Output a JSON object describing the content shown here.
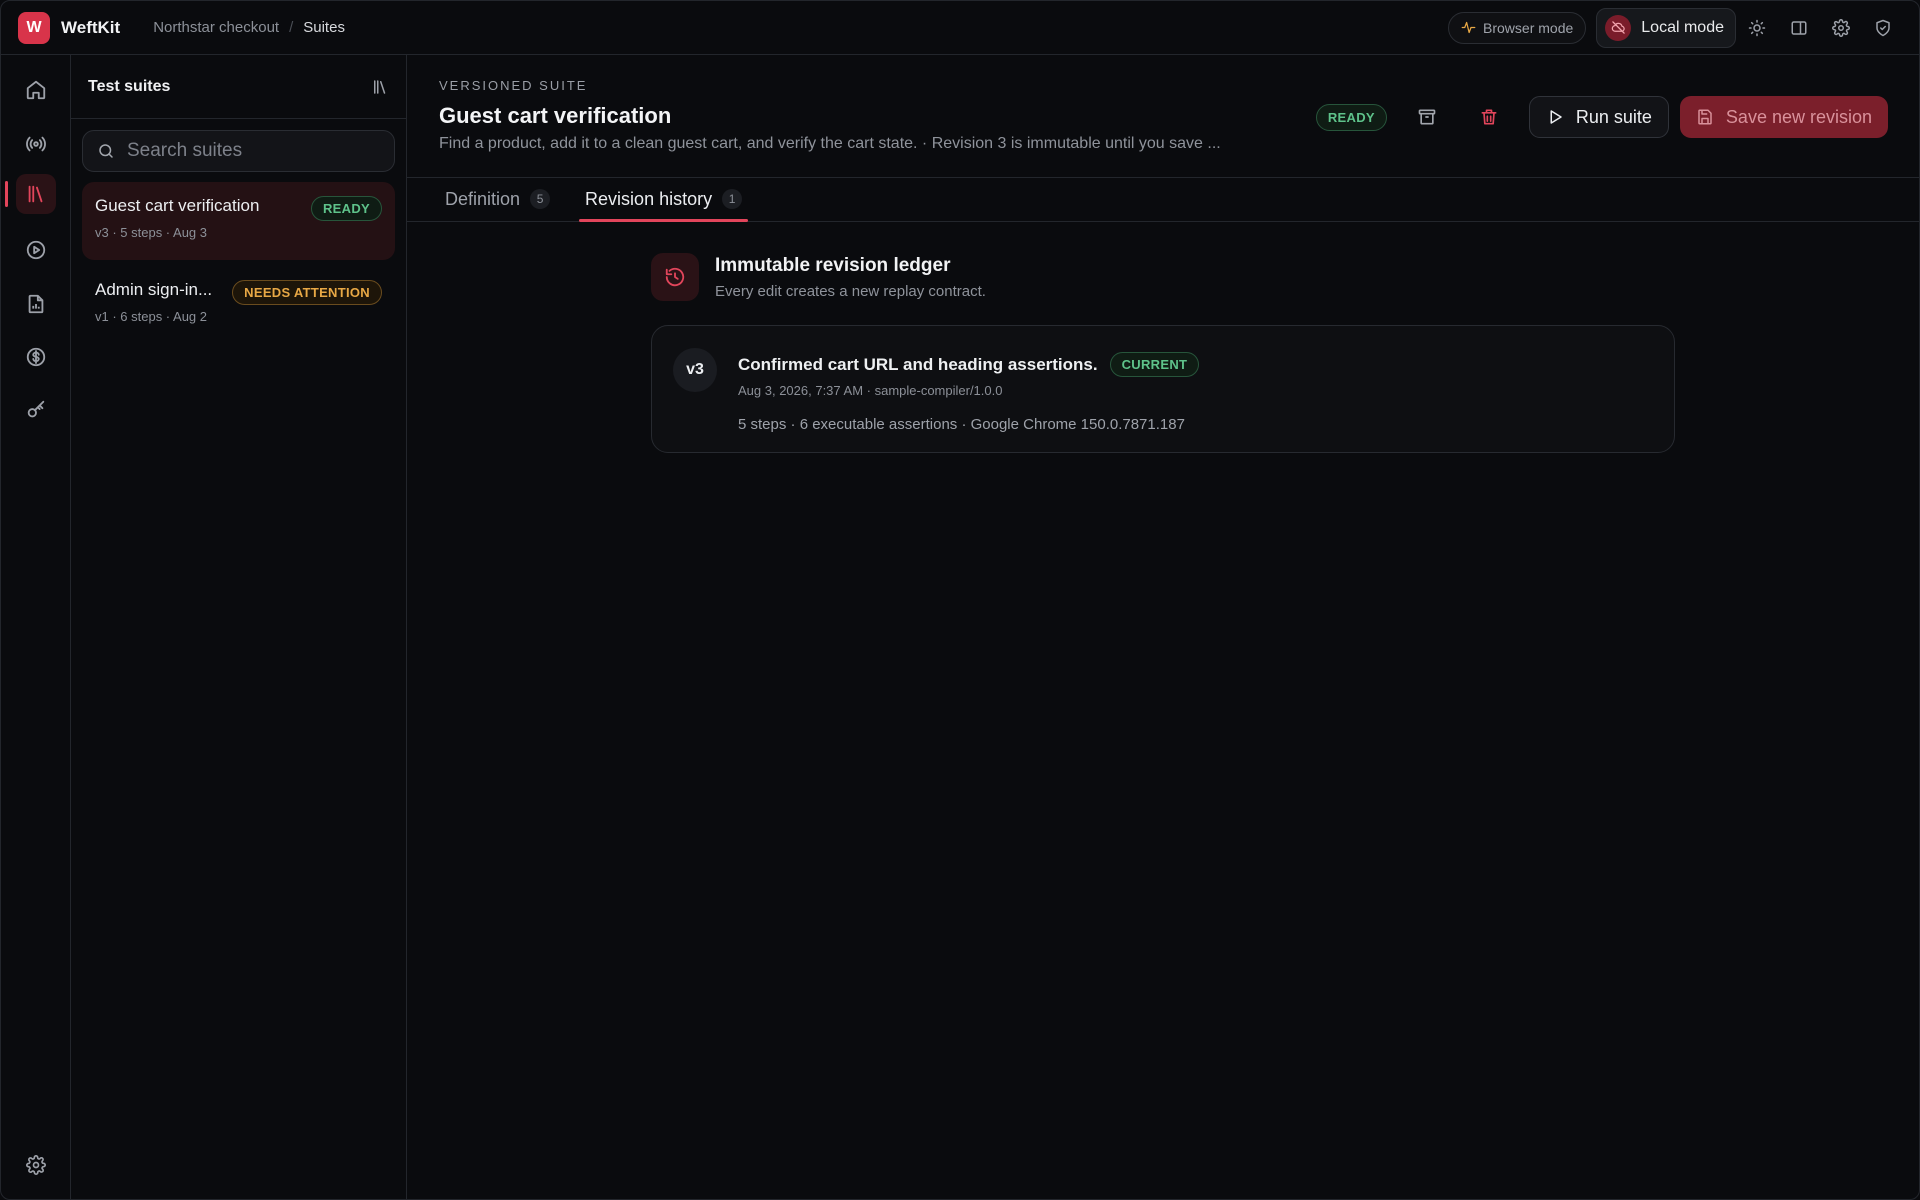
{
  "app": {
    "logo_letter": "W",
    "brand": "WeftKit"
  },
  "breadcrumb": [
    "Northstar checkout",
    "Suites"
  ],
  "breadcrumb_sep": "/",
  "topbar": {
    "browser_mode": "Browser mode",
    "local_mode": "Local mode",
    "icons": [
      "sun-icon",
      "panel-icon",
      "gear-icon",
      "shield-icon"
    ]
  },
  "rail": {
    "items": [
      "home-icon",
      "broadcast-icon",
      "library-icon",
      "play-circle-icon",
      "report-icon",
      "dollar-icon",
      "key-icon"
    ],
    "active": "library-icon",
    "bottom": "gear-icon"
  },
  "suites_panel": {
    "title": "Test suites",
    "search_placeholder": "Search suites",
    "items": [
      {
        "name": "Guest cart verification",
        "meta": "v3 · 5 steps · Aug 3",
        "badge": "READY",
        "selected": true
      },
      {
        "name": "Admin sign-in...",
        "meta": "v1 · 6 steps · Aug 2",
        "badge": "NEEDS ATTENTION",
        "selected": false
      }
    ]
  },
  "main": {
    "eyebrow": "VERSIONED SUITE",
    "title": "Guest cart verification",
    "subtitle": "Find a product, add it to a clean guest cart, and verify the cart state. · Revision 3 is immutable until you save ...",
    "status": "READY",
    "run_label": "Run suite",
    "save_label": "Save new revision",
    "tabs": [
      {
        "label": "Definition",
        "count": "5",
        "active": false
      },
      {
        "label": "Revision history",
        "count": "1",
        "active": true
      }
    ]
  },
  "ledger": {
    "title": "Immutable revision ledger",
    "subtitle": "Every edit creates a new replay contract.",
    "revisions": [
      {
        "version": "v3",
        "title": "Confirmed cart URL and heading assertions.",
        "badge": "CURRENT",
        "meta": "Aug 3, 2026, 7:37 AM · sample-compiler/1.0.0",
        "stats": "5 steps · 6 executable assertions · Google Chrome 150.0.7871.187"
      }
    ]
  },
  "colors": {
    "accent": "#e2455b",
    "ready": "#5ec28a",
    "attention": "#e8a845",
    "background": "#0a0b0e"
  }
}
